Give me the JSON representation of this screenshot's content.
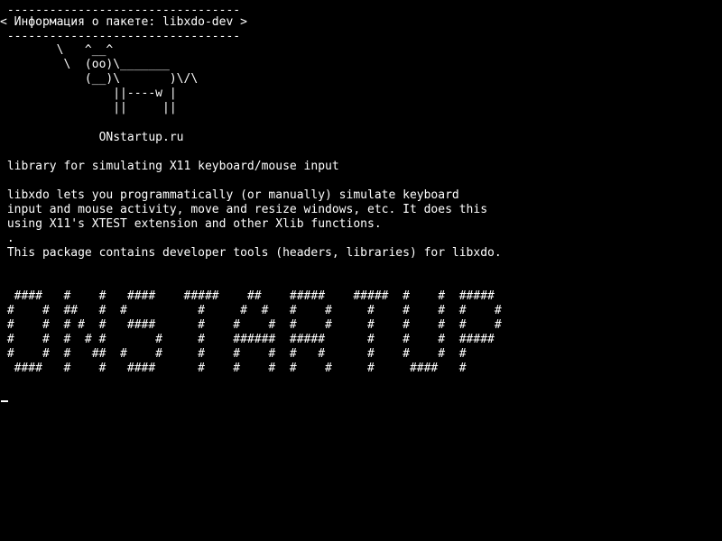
{
  "screen": {
    "background": "#000000",
    "foreground": "#ffffff"
  },
  "lines": [
    " ---------------------------------",
    "< Информация о пакете: libxdo-dev >",
    " ---------------------------------",
    "        \\   ^__^",
    "         \\  (oo)\\_______",
    "            (__)\\       )\\/\\",
    "                ||----w |",
    "                ||     ||",
    "",
    "              ONstartup.ru",
    "",
    " library for simulating X11 keyboard/mouse input",
    "",
    " libxdo lets you programmatically (or manually) simulate keyboard",
    " input and mouse activity, move and resize windows, etc. It does this",
    " using X11's XTEST extension and other Xlib functions.",
    " .",
    " This package contains developer tools (headers, libraries) for libxdo.",
    "",
    "",
    "  ####   #    #   ####    #####    ##    #####    #####  #    #  #####",
    " #    #  ##   #  #          #     #  #   #    #     #    #    #  #    #",
    " #    #  # #  #   ####      #    #    #  #    #     #    #    #  #    #",
    " #    #  #  # #       #     #    ######  #####      #    #    #  #####",
    " #    #  #   ##  #    #     #    #    #  #   #      #    #    #  #",
    "  ####   #    #   ####      #    #    #  #    #     #     ####   #"
  ],
  "cursor": {
    "visible": true
  }
}
